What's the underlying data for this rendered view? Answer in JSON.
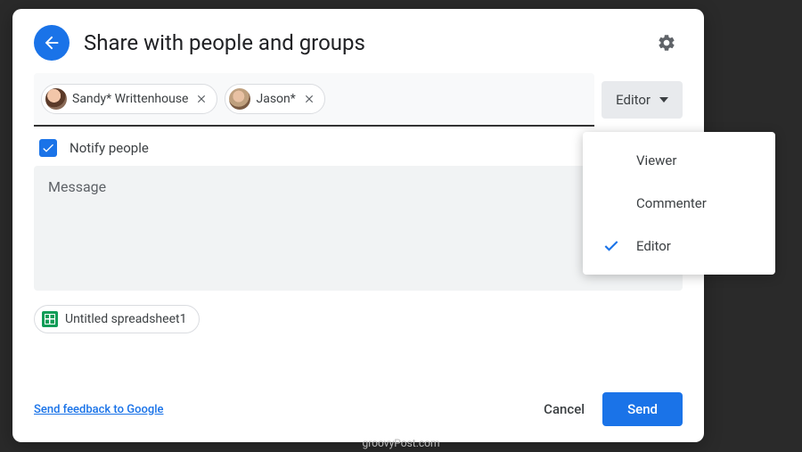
{
  "header": {
    "title": "Share with people and groups"
  },
  "people": {
    "chips": [
      {
        "name": "Sandy* Writtenhouse"
      },
      {
        "name": "Jason*"
      }
    ],
    "selected_role": "Editor"
  },
  "role_menu": {
    "options": [
      {
        "label": "Viewer",
        "selected": false
      },
      {
        "label": "Commenter",
        "selected": false
      },
      {
        "label": "Editor",
        "selected": true
      }
    ]
  },
  "notify": {
    "label": "Notify people",
    "checked": true
  },
  "message": {
    "placeholder": "Message"
  },
  "attachment": {
    "name": "Untitled spreadsheet1"
  },
  "footer": {
    "feedback_label": "Send feedback to Google",
    "cancel_label": "Cancel",
    "send_label": "Send"
  },
  "watermark": "groovyPost.com"
}
